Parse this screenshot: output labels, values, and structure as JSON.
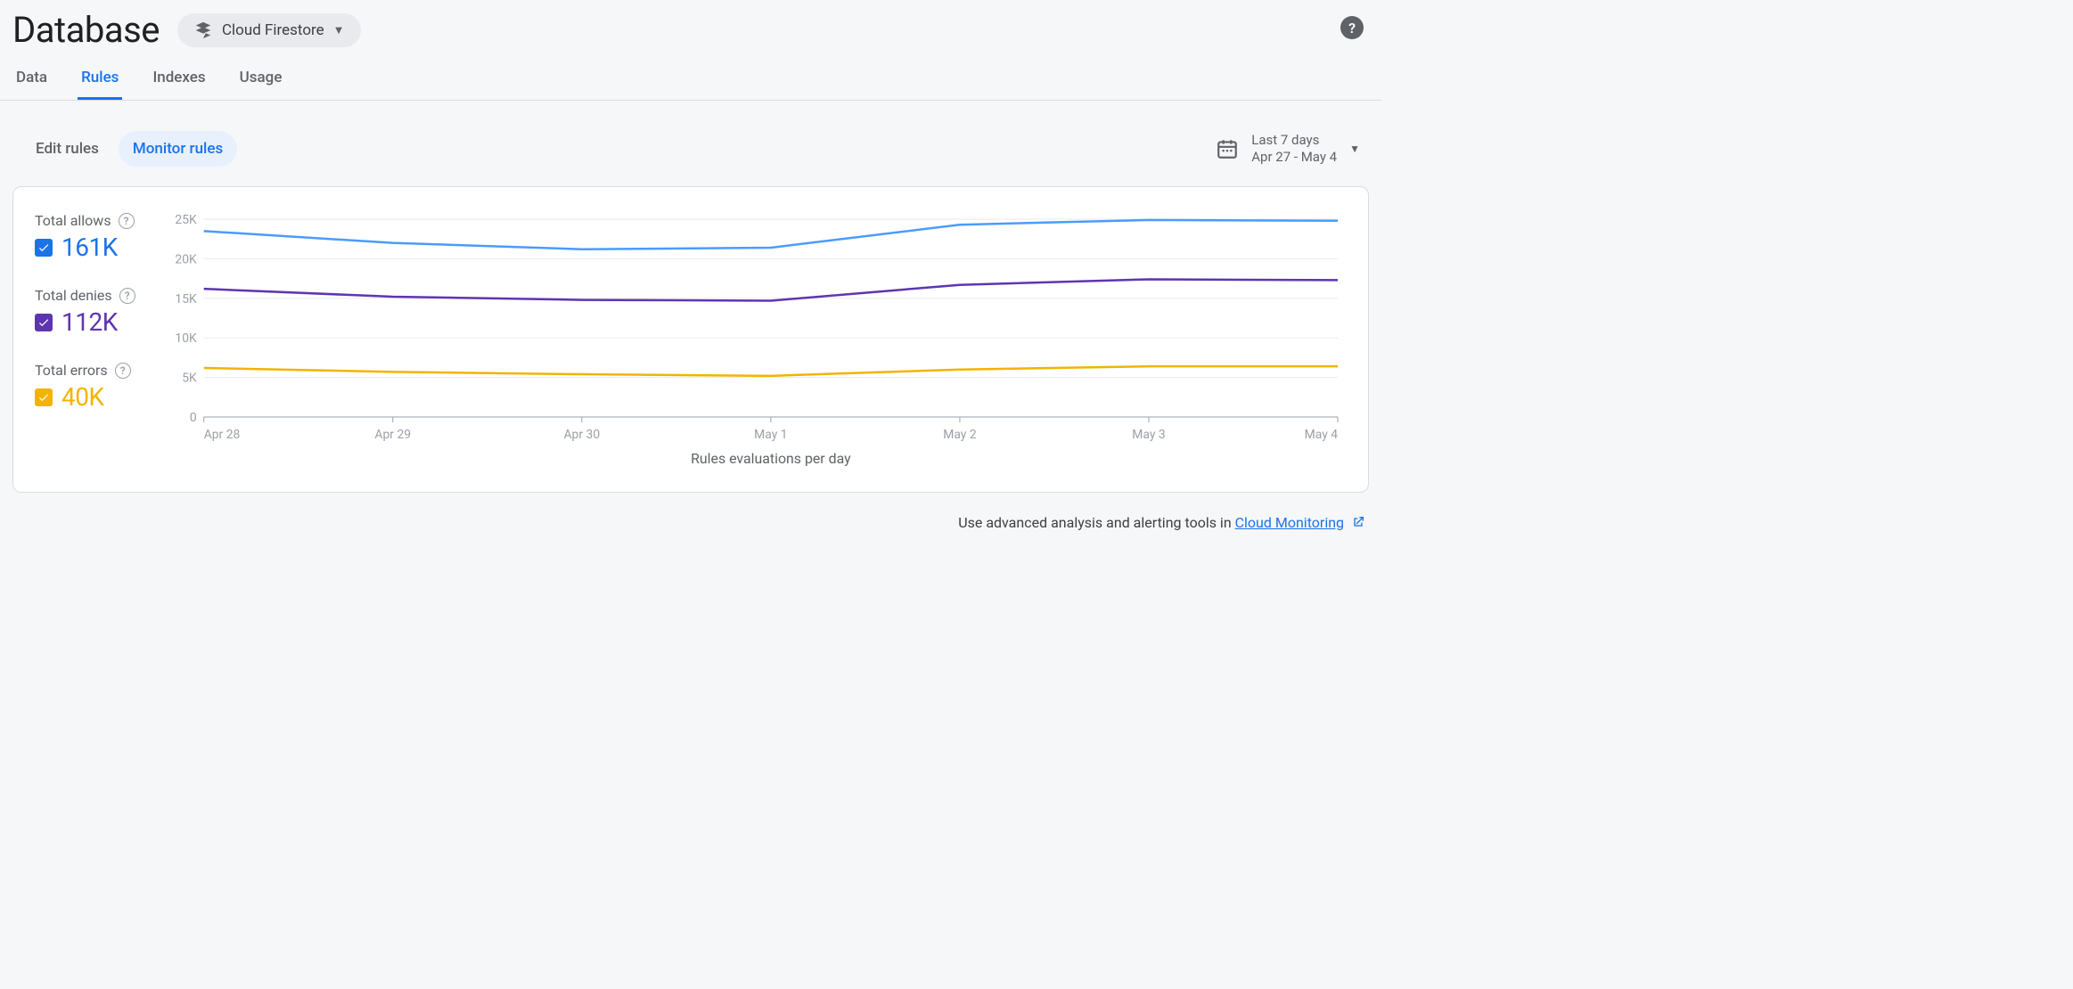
{
  "header": {
    "title": "Database",
    "selector_label": "Cloud Firestore"
  },
  "tabs": [
    "Data",
    "Rules",
    "Indexes",
    "Usage"
  ],
  "active_tab_index": 1,
  "sub_tabs": [
    "Edit rules",
    "Monitor rules"
  ],
  "active_sub_tab_index": 1,
  "date_range": {
    "label": "Last 7 days",
    "range": "Apr 27 - May 4"
  },
  "legend": [
    {
      "label": "Total allows",
      "value": "161K",
      "color": "#1a73e8"
    },
    {
      "label": "Total denies",
      "value": "112K",
      "color": "#5e35b1"
    },
    {
      "label": "Total errors",
      "value": "40K",
      "color": "#f2b400"
    }
  ],
  "chart_data": {
    "type": "line",
    "title": "",
    "xlabel": "Rules evaluations per day",
    "ylabel": "",
    "ylim": [
      0,
      25000
    ],
    "categories": [
      "Apr 28",
      "Apr 29",
      "Apr 30",
      "May 1",
      "May 2",
      "May 3",
      "May 4"
    ],
    "y_ticks": [
      0,
      5000,
      10000,
      15000,
      20000,
      25000
    ],
    "y_tick_labels": [
      "0",
      "5K",
      "10K",
      "15K",
      "20K",
      "25K"
    ],
    "series": [
      {
        "name": "Total allows",
        "color": "#4b9bff",
        "values": [
          23500,
          22000,
          21200,
          21400,
          24300,
          24900,
          24800
        ]
      },
      {
        "name": "Total denies",
        "color": "#5e35b1",
        "values": [
          16200,
          15200,
          14800,
          14700,
          16700,
          17400,
          17300
        ]
      },
      {
        "name": "Total errors",
        "color": "#f2b400",
        "values": [
          6200,
          5700,
          5400,
          5200,
          6000,
          6400,
          6400
        ]
      }
    ]
  },
  "footer": {
    "prefix": "Use advanced analysis and alerting tools in ",
    "link_text": "Cloud Monitoring"
  }
}
